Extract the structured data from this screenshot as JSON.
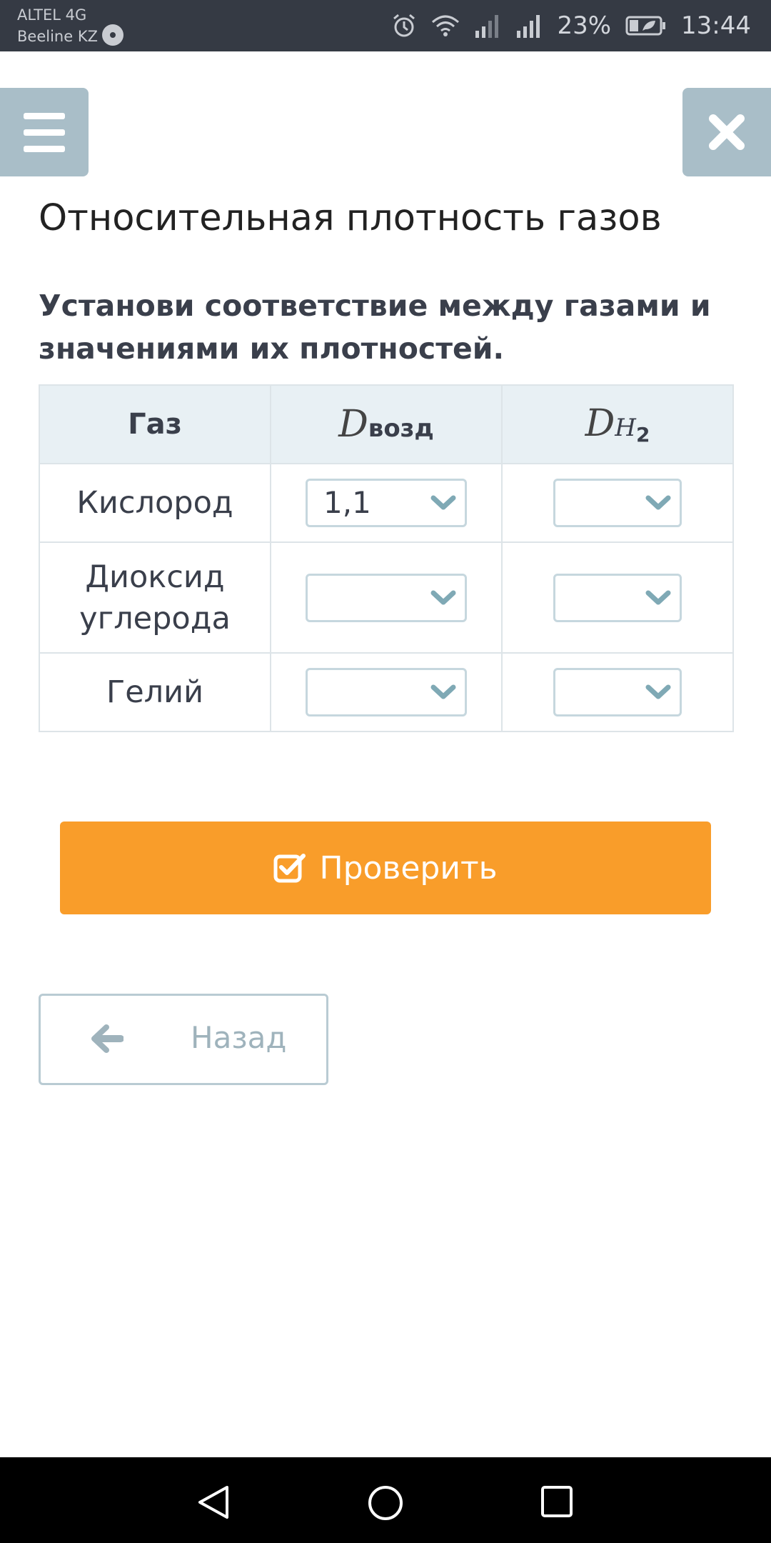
{
  "status_bar": {
    "carrier_1": "ALTEL 4G",
    "carrier_2": "Beeline KZ",
    "battery_percent": "23%",
    "time": "13:44"
  },
  "header": {
    "menu_icon": "hamburger-menu-icon",
    "close_icon": "close-icon",
    "title": "Относительная плотность газов"
  },
  "question": "Установи соответствие между газами и значениями их плотностей.",
  "table": {
    "col_gas": "Газ",
    "col_air_symbol": "D",
    "col_air_sub": "возд",
    "col_h2_symbol": "D",
    "col_h2_sub_letter": "H",
    "col_h2_sub_index": "2",
    "rows": [
      {
        "gas": "Кислород",
        "air_value": "1,1",
        "h2_value": ""
      },
      {
        "gas_line1": "Диоксид",
        "gas_line2": "углерода",
        "air_value": "",
        "h2_value": ""
      },
      {
        "gas": "Гелий",
        "air_value": "",
        "h2_value": ""
      }
    ]
  },
  "check_button": {
    "label": "Проверить",
    "icon": "check-square-icon"
  },
  "back_button": {
    "label": "Назад",
    "icon": "arrow-left-icon"
  },
  "colors": {
    "status_bar": "#353a44",
    "accent_orange": "#f99d2a",
    "side_button": "#a9bec8",
    "header_cell": "#e8f0f4",
    "chevron": "#7fa9b5"
  }
}
